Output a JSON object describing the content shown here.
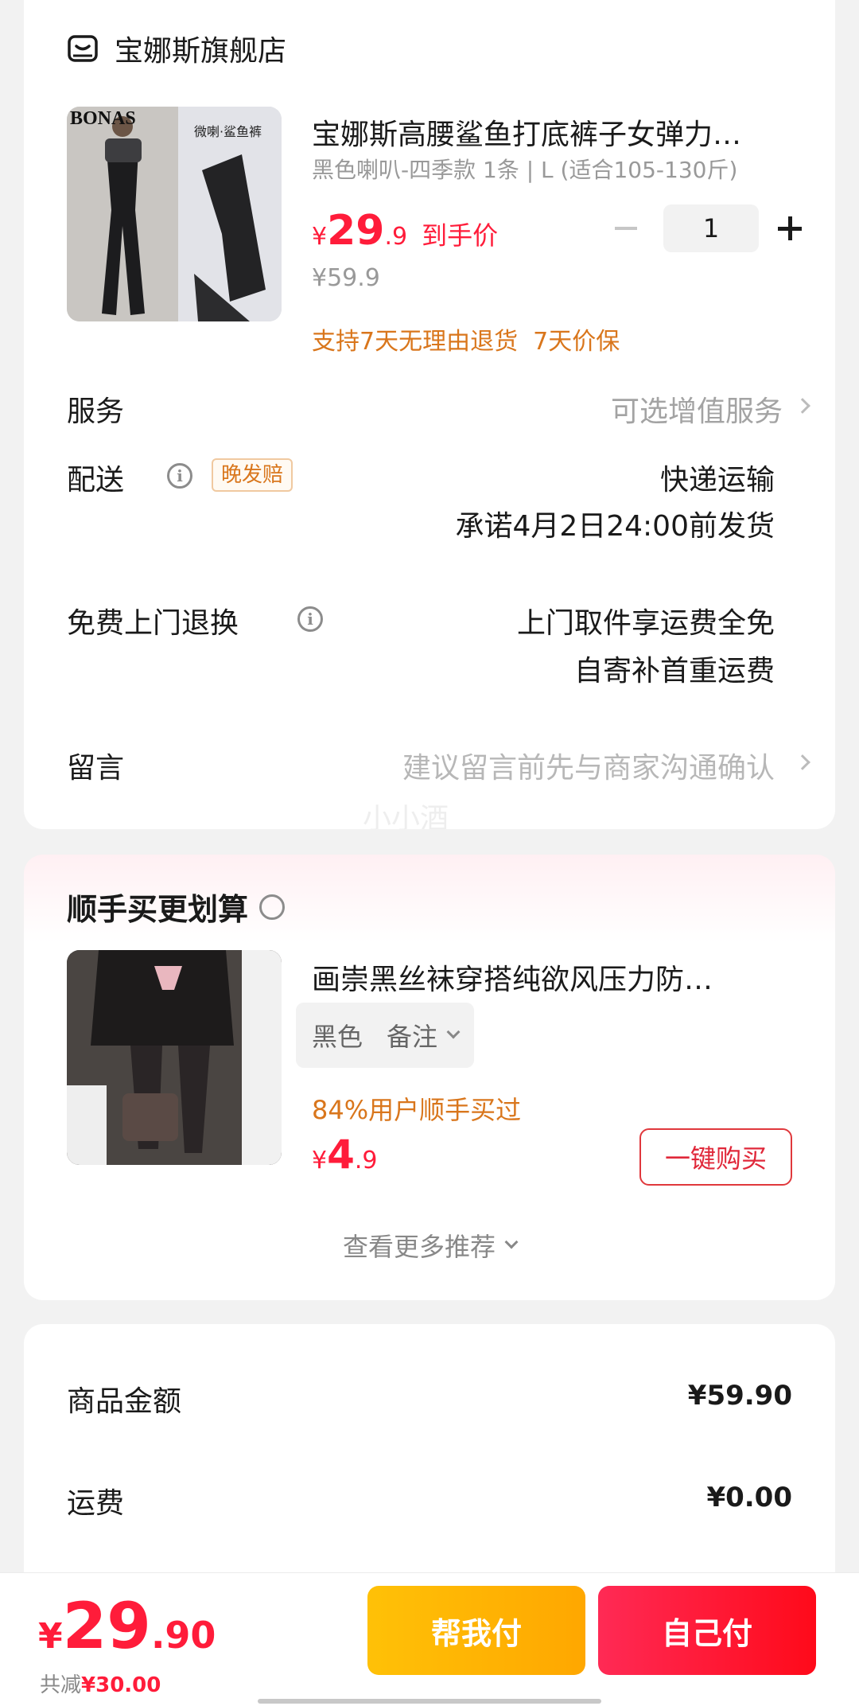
{
  "store": {
    "name": "宝娜斯旗舰店",
    "icon": "store-icon"
  },
  "product": {
    "title": "宝娜斯高腰鲨鱼打底裤子女弹力…",
    "variant": "黑色喇叭-四季款 1条 | L (适合105-130斤)",
    "price_symbol": "¥",
    "price_int": "29",
    "price_dec": ".9",
    "price_note": "到手价",
    "original_price": "¥59.9",
    "quantity": "1",
    "guarantee": "支持7天无理由退货  7天价保",
    "image_brand": "BONAS",
    "image_tag": "微喇·鲨鱼裤"
  },
  "rows": {
    "service_label": "服务",
    "service_value": "可选增值服务",
    "delivery_label": "配送",
    "delivery_badge": "晚发赔",
    "delivery_line1": "快递运输",
    "delivery_line2": "承诺4月2日24:00前发货",
    "return_label": "免费上门退换",
    "return_line1": "上门取件享运费全免",
    "return_line2": "自寄补首重运费",
    "message_label": "留言",
    "message_placeholder": "建议留言前先与商家沟通确认",
    "watermark": "小小酒"
  },
  "addon": {
    "section_title": "顺手买更划算",
    "title": "画崇黑丝袜穿搭纯欲风压力防…",
    "variant_color": "黑色",
    "variant_note": "备注",
    "bought_by": "84%用户顺手买过",
    "price_symbol": "¥",
    "price_int": "4",
    "price_dec": ".9",
    "buy_button": "一键购买",
    "more": "查看更多推荐"
  },
  "summary": {
    "goods_label": "商品金额",
    "goods_value": "¥59.90",
    "shipping_label": "运费",
    "shipping_value": "¥0.00"
  },
  "footer": {
    "total_symbol": "¥",
    "total_int": "29",
    "total_dec": ".90",
    "saved_label": "共减",
    "saved_value": "¥30.00",
    "help_pay": "帮我付",
    "self_pay": "自己付"
  },
  "colors": {
    "accent_red": "#ff1c3a",
    "orange_text": "#d9761c",
    "help_pay_bg": "#ffb400",
    "self_pay_bg": "#ff1744"
  }
}
